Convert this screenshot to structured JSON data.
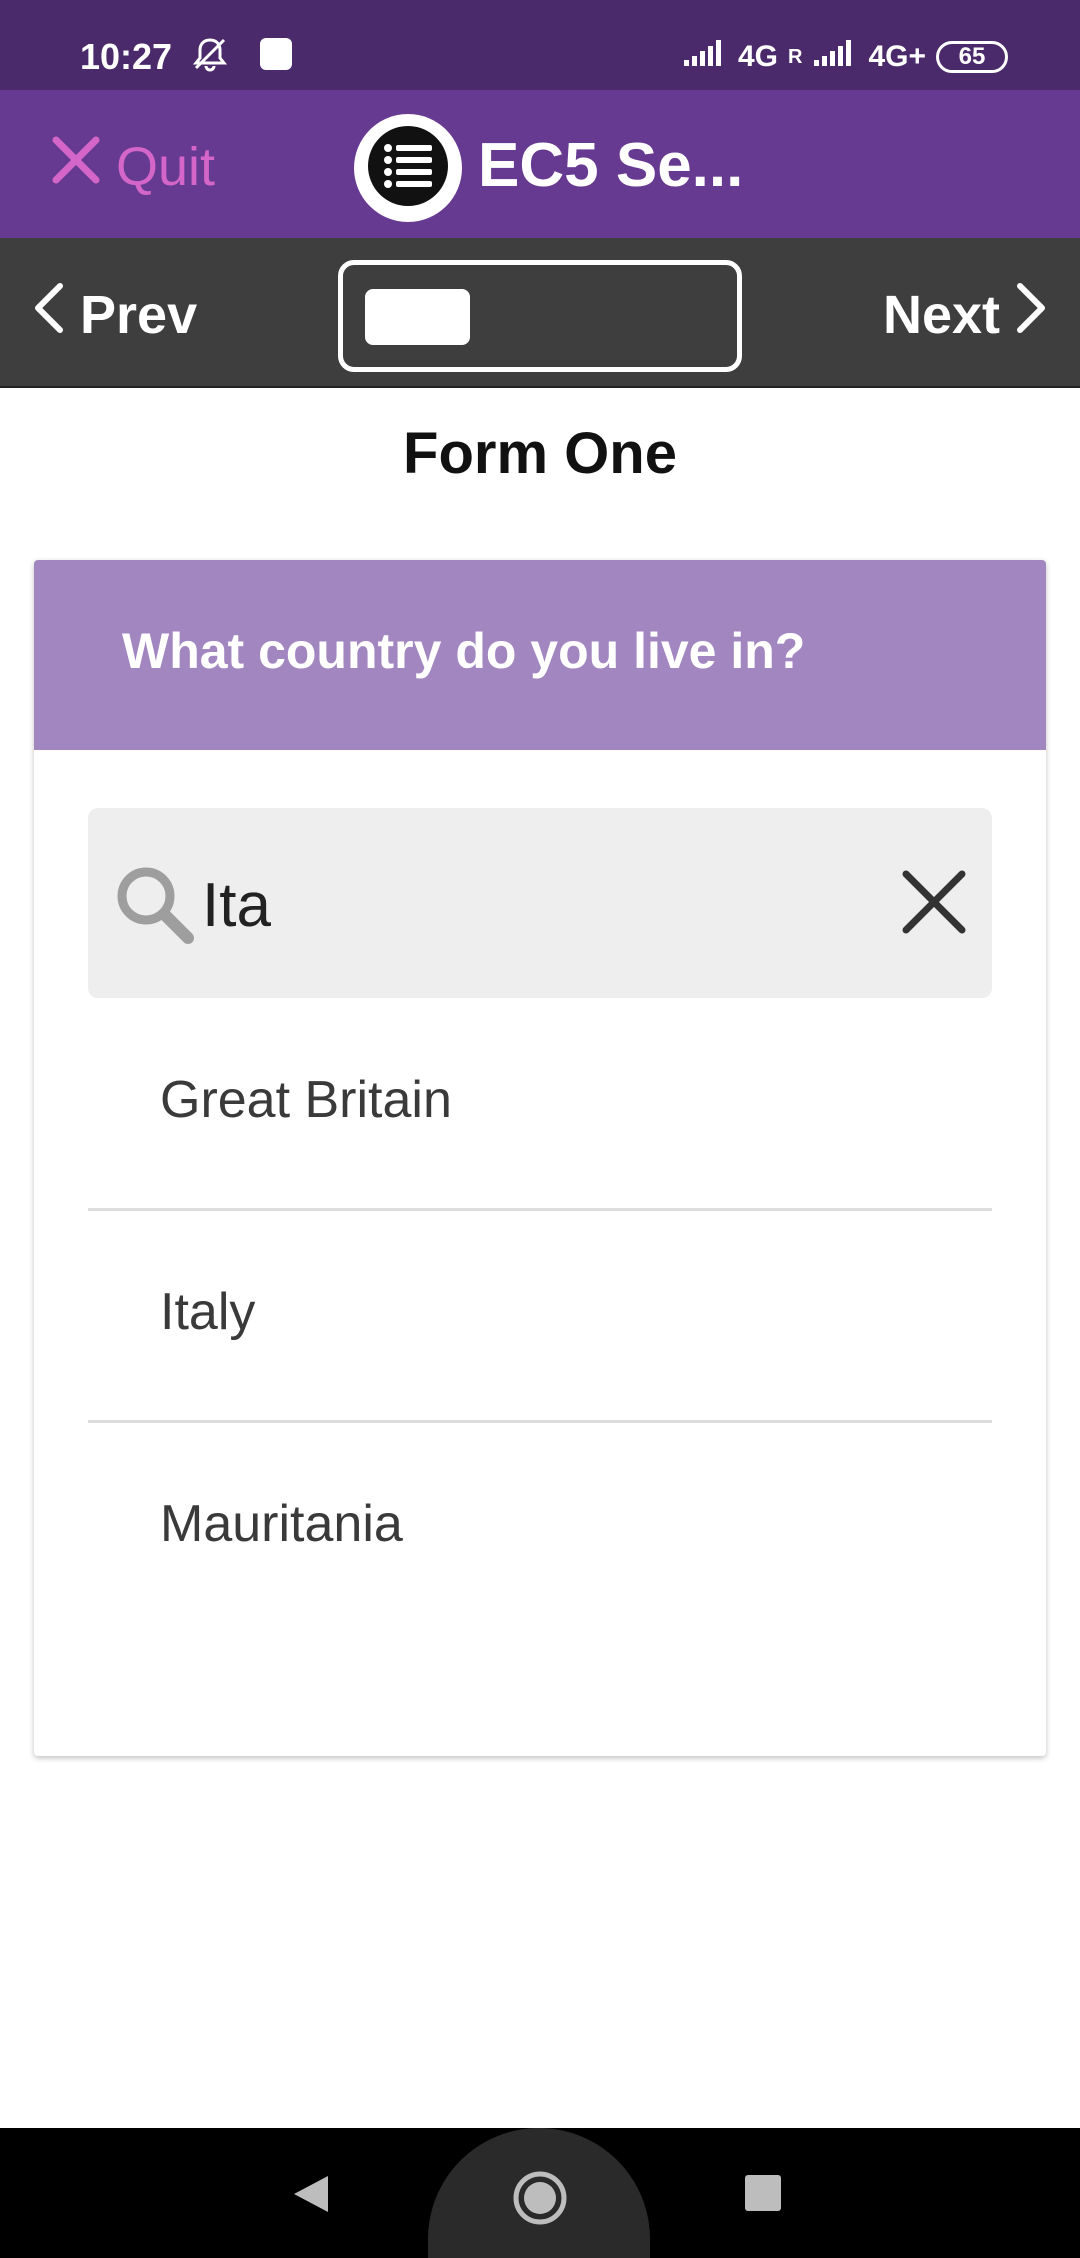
{
  "status_bar": {
    "time": "10:27",
    "network_1": "4G",
    "network_2": "4G+",
    "roaming": "R",
    "battery": "65"
  },
  "app_bar": {
    "quit_label": "Quit",
    "title": "EC5 Se..."
  },
  "nav": {
    "prev_label": "Prev",
    "next_label": "Next",
    "progress": 0.3
  },
  "form": {
    "title": "Form One",
    "question": "What country do you live in?",
    "search": {
      "value": "Ita",
      "placeholder": ""
    },
    "results": [
      {
        "label": "Great Britain"
      },
      {
        "label": "Italy"
      },
      {
        "label": "Mauritania"
      }
    ]
  },
  "colors": {
    "status_bar": "#4b2a6b",
    "app_bar": "#673a91",
    "quit": "#d466c9",
    "nav_bar": "#3e3e3e",
    "question_header": "#a286c0",
    "search_bg": "#eeeeee"
  },
  "icons": {
    "quit": "close-icon",
    "logo": "list-icon",
    "prev": "chevron-left-icon",
    "next": "chevron-right-icon",
    "search": "search-icon",
    "clear": "close-icon",
    "back": "triangle-back-icon",
    "home": "circle-home-icon",
    "recents": "square-recents-icon"
  }
}
